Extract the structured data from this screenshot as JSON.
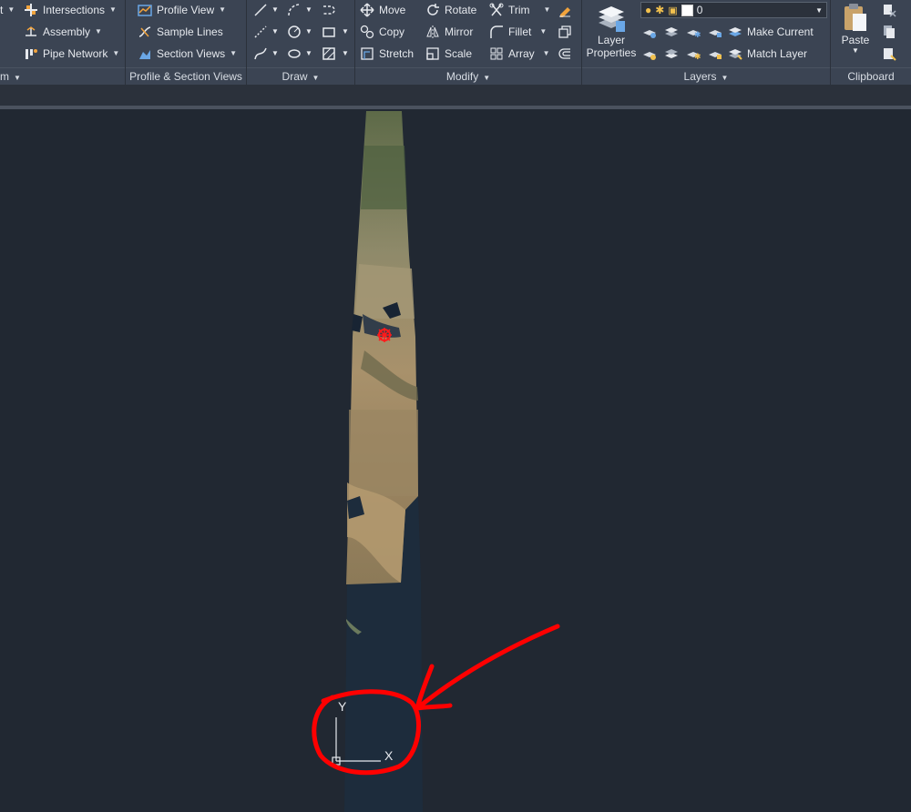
{
  "ribbon": {
    "left_partial": {
      "t_label": "t",
      "m_label": "m"
    },
    "civil": {
      "intersections": "Intersections",
      "assembly": "Assembly",
      "pipe_network": "Pipe Network"
    },
    "profile_section": {
      "profile_view": "Profile View",
      "sample_lines": "Sample Lines",
      "section_views": "Section Views",
      "title": "Profile & Section Views"
    },
    "draw": {
      "title": "Draw"
    },
    "modify": {
      "move": "Move",
      "rotate": "Rotate",
      "trim": "Trim",
      "copy": "Copy",
      "mirror": "Mirror",
      "fillet": "Fillet",
      "stretch": "Stretch",
      "scale": "Scale",
      "array": "Array",
      "title": "Modify"
    },
    "layers": {
      "layer_properties_line1": "Layer",
      "layer_properties_line2": "Properties",
      "current_layer": "0",
      "make_current": "Make Current",
      "match_layer": "Match Layer",
      "title": "Layers"
    },
    "clipboard": {
      "paste": "Paste",
      "title": "Clipboard"
    }
  },
  "canvas": {
    "ucs": {
      "x_label": "X",
      "y_label": "Y"
    }
  },
  "colors": {
    "ribbon_bg": "#3b4453",
    "canvas_bg": "#212832",
    "annotation_red": "#ff0000",
    "icon_blue": "#6aa7e6",
    "icon_yellow": "#f2c14e"
  }
}
